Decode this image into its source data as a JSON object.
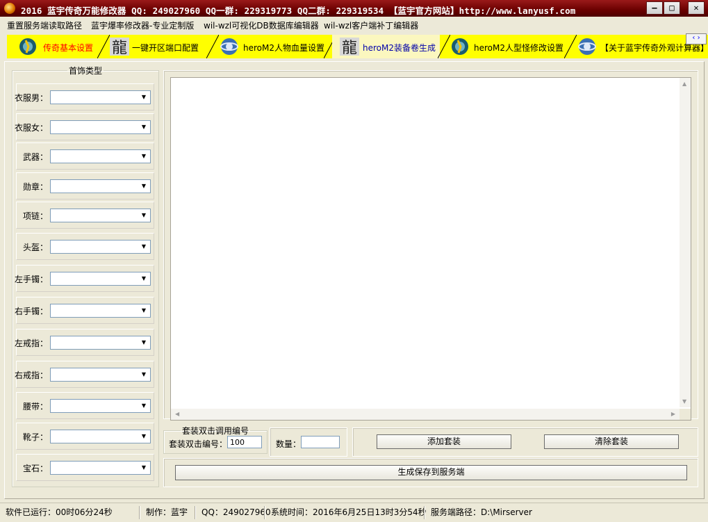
{
  "window": {
    "title": "2016 蓝宇传奇万能修改器  QQ: 249027960 QQ一群: 229319773 QQ二群: 229319534  【蓝宇官方网站】http://www.lanyusf.com",
    "min_label": "—",
    "max_label": "□",
    "close_label": "✕"
  },
  "menu": [
    "重置服务端读取路径",
    "蓝宇爆率修改器-专业定制版",
    "wil-wzl可视化DB数据库编辑器",
    "wil-wzl客户端补丁编辑器"
  ],
  "tabs": [
    {
      "label": "传奇基本设置",
      "icon": "gear-icon",
      "color": "#ff0000"
    },
    {
      "label": "一键开区端口配置",
      "icon": "dragon-icon",
      "color": "#000000"
    },
    {
      "label": "heroM2人物血量设置",
      "icon": "globe-icon",
      "color": "#000000"
    },
    {
      "label": "heroM2装备卷生成",
      "icon": "dragon-icon",
      "color": "#0000aa",
      "selected": true
    },
    {
      "label": "heroM2人型怪修改设置",
      "icon": "gear-icon",
      "color": "#000000"
    },
    {
      "label": "【关于蓝宇传奇外观计算器】",
      "icon": "globe-icon",
      "color": "#000000"
    }
  ],
  "tab_scroll": "‹ ›",
  "accessories": {
    "group_title": "首饰类型",
    "items": [
      {
        "label": "衣服男：",
        "value": ""
      },
      {
        "label": "衣服女：",
        "value": ""
      },
      {
        "label": "武器：",
        "value": ""
      },
      {
        "label": "勋章：",
        "value": ""
      },
      {
        "label": "项链：",
        "value": ""
      },
      {
        "label": "头盔：",
        "value": ""
      },
      {
        "label": "左手镯：",
        "value": ""
      },
      {
        "label": "右手镯：",
        "value": ""
      },
      {
        "label": "左戒指：",
        "value": ""
      },
      {
        "label": "右戒指：",
        "value": ""
      },
      {
        "label": "腰带：",
        "value": ""
      },
      {
        "label": "靴子：",
        "value": ""
      },
      {
        "label": "宝石：",
        "value": ""
      }
    ]
  },
  "memo": {
    "content": ""
  },
  "set_section": {
    "group_title": "套装双击调用编号",
    "id_label": "套装双击编号：",
    "id_value": "100",
    "qty_label": "数量：",
    "qty_value": ""
  },
  "buttons": {
    "add_set": "添加套装",
    "clear_set": "清除套装",
    "generate": "生成保存到服务端"
  },
  "status": {
    "runtime": "软件已运行：00时06分24秒",
    "author": "制作：蓝宇",
    "qq": "QQ：249027960",
    "system_time": "系统时间：2016年6月25日13时3分54秒",
    "server_path": "服务端路径：D:\\Mirserver"
  }
}
